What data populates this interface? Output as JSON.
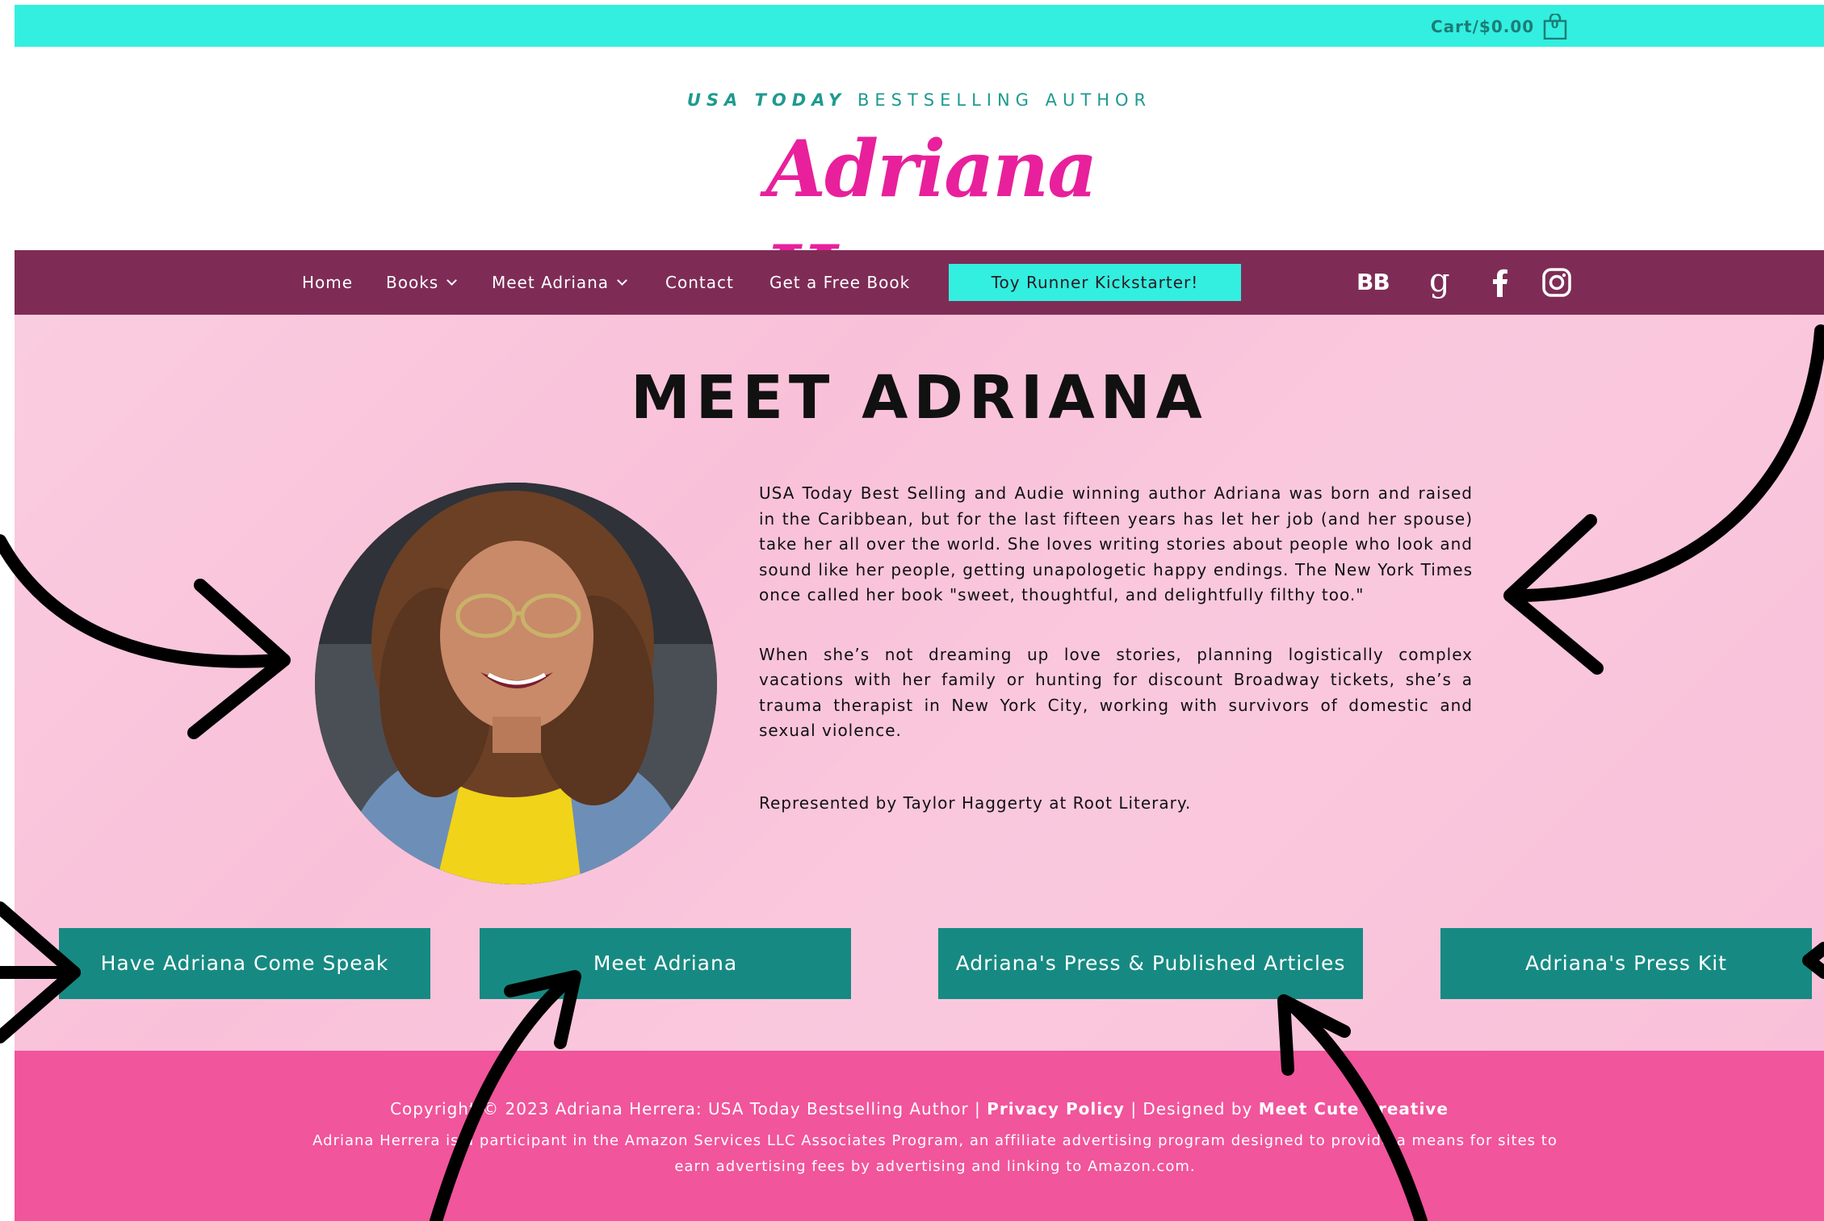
{
  "topbar": {
    "cart_label": "Cart/$0.00",
    "cart_count": "0"
  },
  "header": {
    "tagline_strong": "USA TODAY",
    "tagline_rest": "BESTSELLING AUTHOR",
    "logo_text": "Adriana Herrera"
  },
  "nav": {
    "items": [
      "Home",
      "Books",
      "Meet Adriana",
      "Contact",
      "Get a Free Book"
    ],
    "cta": "Toy Runner Kickstarter!",
    "social": {
      "bookbub": "BB",
      "goodreads": "g"
    }
  },
  "main": {
    "title": "MEET ADRIANA",
    "bio": [
      "USA Today Best Selling and Audie winning author Adriana was born and raised in the Caribbean, but for the last fifteen years has let her job (and her spouse) take her all over the world. She loves writing stories about people who look and sound like her people, getting unapologetic happy endings. The New York Times once called her book \"sweet, thoughtful, and delightfully filthy too.\"",
      "When she’s not dreaming up love stories, planning logistically complex vacations with her family or hunting for discount Broadway tickets, she’s a trauma therapist in New York City, working with survivors of domestic and sexual violence.",
      "Represented by Taylor Haggerty at  Root Literary."
    ],
    "buttons": [
      "Have Adriana Come Speak",
      "Meet Adriana",
      "Adriana's Press & Published Articles",
      "Adriana's Press Kit"
    ]
  },
  "footer": {
    "copyright_prefix": "Copyright © 2023 Adriana Herrera: USA Today Bestselling Author |",
    "privacy": "Privacy Policy",
    "designed_by": "| Designed by",
    "designer": "Meet Cute Creative",
    "disclosure": "Adriana Herrera is a participant in the Amazon Services LLC Associates Program, an affiliate advertising program designed to provide a means for sites to earn advertising fees by advertising and linking to Amazon.com."
  },
  "colors": {
    "topbar": "#33efe0",
    "nav": "#7e2c56",
    "main_bg": "#f9c1d9",
    "button": "#168a82",
    "footer": "#f1559b",
    "logo": "#e8209c"
  }
}
